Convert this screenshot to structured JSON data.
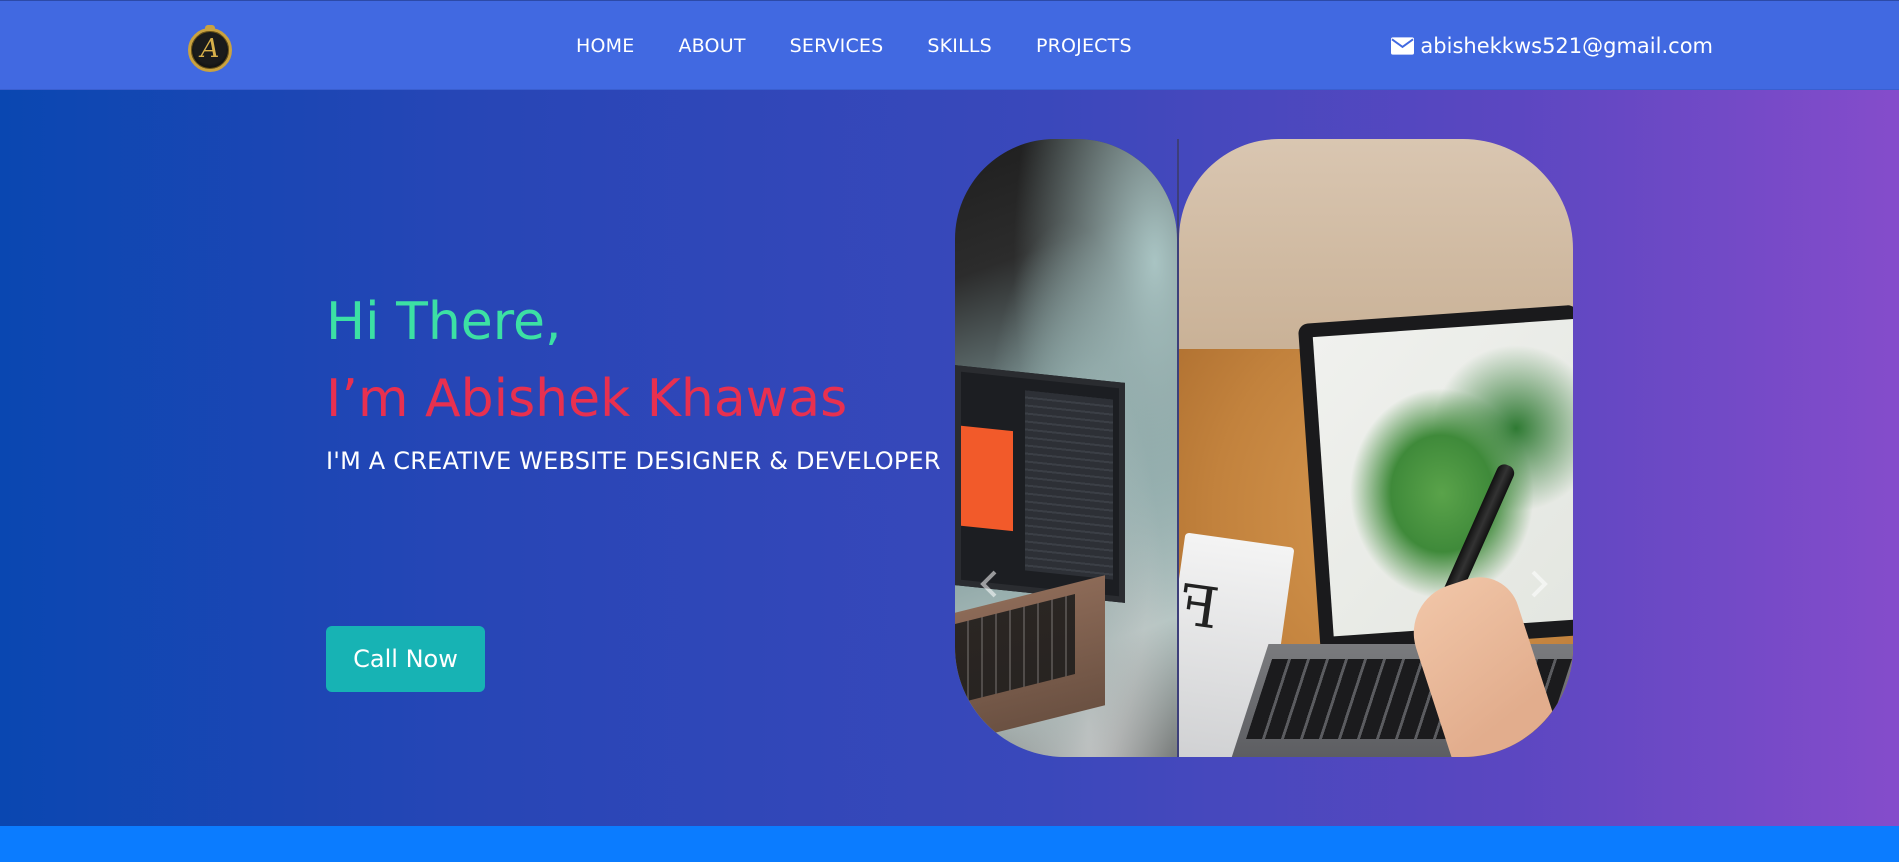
{
  "navbar": {
    "logo_letter": "A",
    "links": [
      "HOME",
      "ABOUT",
      "SERVICES",
      "SKILLS",
      "PROJECTS"
    ],
    "email": "abishekkws521@gmail.com"
  },
  "hero": {
    "greeting": "Hi There,",
    "name": "I’m Abishek Khawas",
    "tagline": "I'M A CREATIVE WEBSITE DESIGNER & DEVELOPER",
    "cta_label": "Call Now"
  },
  "icons": {
    "email": "envelope-icon",
    "prev": "chevron-left-icon",
    "next": "chevron-right-icon"
  },
  "colors": {
    "navbar": "#4169e1",
    "greeting": "#3ce0a4",
    "name": "#e8304f",
    "cta": "#17b3b4",
    "bottom_bar": "#0b7cff"
  }
}
